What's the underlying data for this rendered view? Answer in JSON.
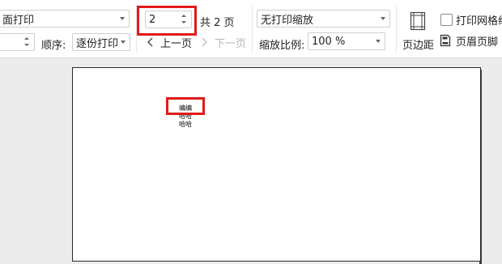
{
  "toolbar": {
    "print_mode_value": "面打印",
    "collate_label": "顺序:",
    "collate_value": "逐份打印",
    "page_current": "2",
    "page_total": "共 2 页",
    "prev_page": "上一页",
    "next_page": "下一页",
    "scaling_value": "无打印缩放",
    "zoom_label": "缩放比例:",
    "zoom_value": "100 %",
    "margins_label": "页边距",
    "gridlines_label": "打印网格线",
    "header_footer_label": "页眉页脚"
  },
  "preview": {
    "lines": [
      "编编",
      "哈哈",
      "哈哈"
    ]
  },
  "colors": {
    "highlight": "#e01b1b",
    "toolbar_bg": "#ffffff",
    "workspace_bg": "#ececec"
  }
}
